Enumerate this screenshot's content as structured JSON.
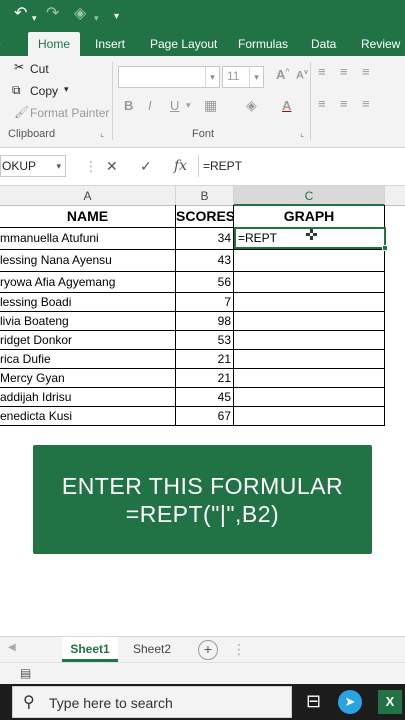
{
  "ribbon": {
    "tabs": [
      "Home",
      "Insert",
      "Page Layout",
      "Formulas",
      "Data",
      "Review"
    ],
    "clipboard": {
      "cut": "Cut",
      "copy": "Copy",
      "format_painter": "Format Painter",
      "label": "Clipboard"
    },
    "font": {
      "size": "11",
      "label": "Font",
      "bold": "B",
      "italic": "I",
      "underline": "U"
    }
  },
  "formula_bar": {
    "name_box": "OKUP",
    "fx": "fx",
    "formula": "=REPT"
  },
  "grid": {
    "columns": [
      "A",
      "B",
      "C"
    ],
    "headers": {
      "name": "NAME",
      "scores": "SCORES",
      "graph": "GRAPH"
    },
    "rows": [
      {
        "name": "mmanuella Atufuni",
        "score": "34"
      },
      {
        "name": "lessing Nana Ayensu",
        "score": "43"
      },
      {
        "name": "ryowa Afia Agyemang",
        "score": "56"
      },
      {
        "name": "lessing Boadi",
        "score": "7"
      },
      {
        "name": "livia Boateng",
        "score": "98"
      },
      {
        "name": "ridget Donkor",
        "score": "53"
      },
      {
        "name": "rica Dufie",
        "score": "21"
      },
      {
        "name": "Mercy Gyan",
        "score": "21"
      },
      {
        "name": "addijah Idrisu",
        "score": "45"
      },
      {
        "name": "enedicta Kusi",
        "score": "67"
      }
    ],
    "active_cell_value": "=REPT"
  },
  "banner": {
    "line1": "ENTER THIS FORMULAR",
    "line2": "=REPT(\"|\",B2)"
  },
  "sheets": [
    "Sheet1",
    "Sheet2"
  ],
  "sheet_add": "+",
  "taskbar": {
    "search_placeholder": "Type here to search"
  },
  "colors": {
    "excel_green": "#217346",
    "taskbar": "#1c1c1c"
  }
}
